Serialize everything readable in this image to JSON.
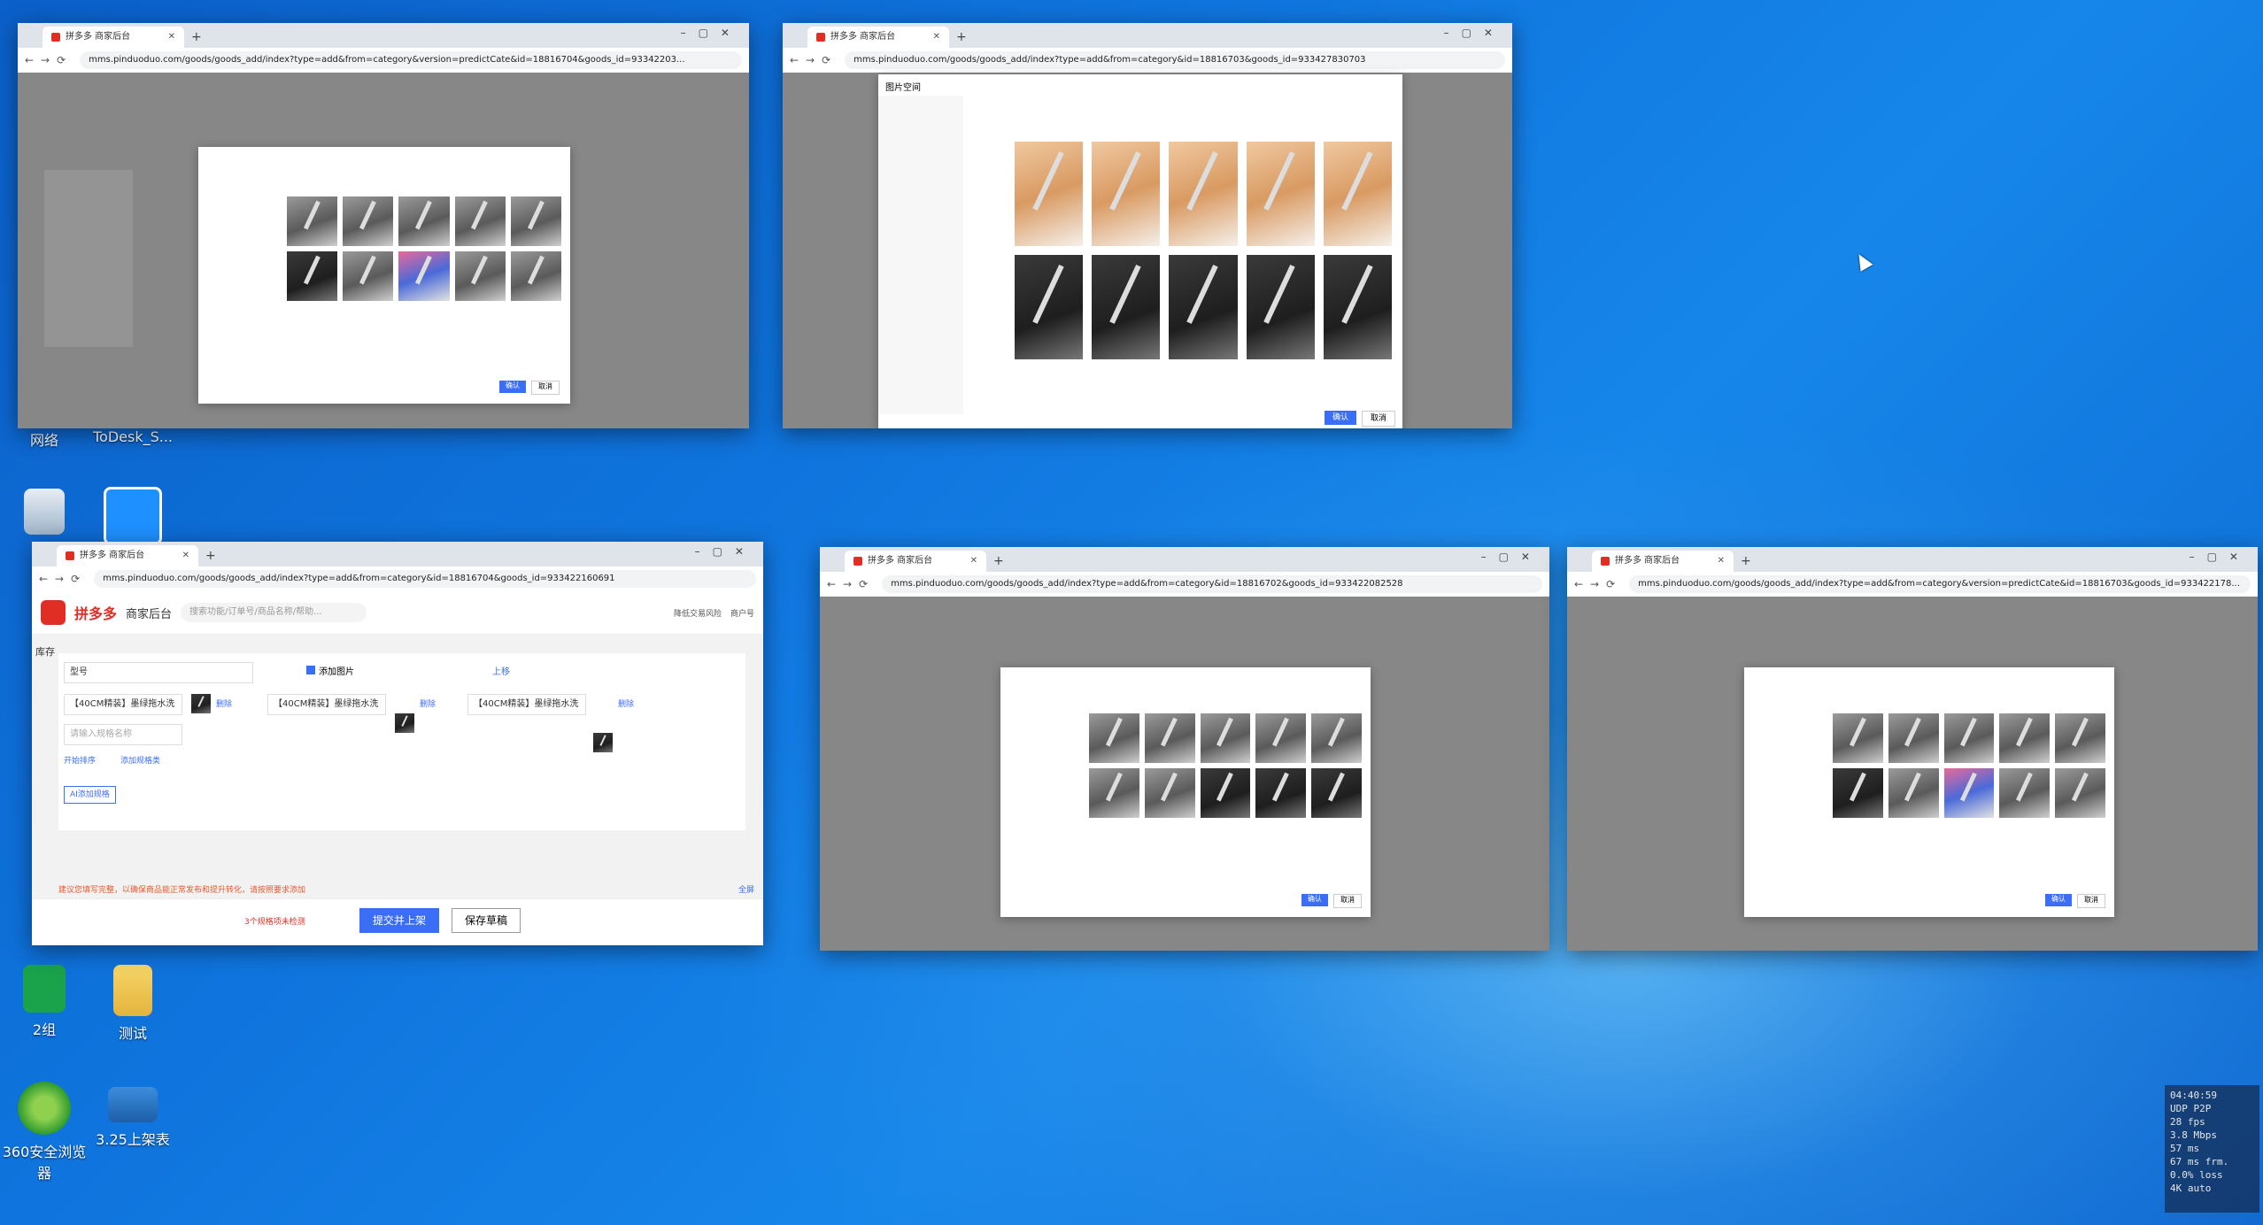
{
  "desktop": {
    "icons": [
      {
        "label": "网络"
      },
      {
        "label": "ToDesk_S..."
      },
      {
        "label": "2组"
      },
      {
        "label": "测试"
      },
      {
        "label": "360安全浏览器"
      },
      {
        "label": "3.25上架表"
      }
    ]
  },
  "browser": {
    "tab_title": "拼多多 商家后台",
    "url_main": "mms.pinduoduo.com/goods/goods_add/index?type=add&from=category&id=18816704&goods_id=933422160691",
    "url_top_left": "mms.pinduoduo.com/goods/goods_add/index?type=add&from=category&version=predictCate&id=18816704&goods_id=93342203...",
    "url_top_right": "mms.pinduoduo.com/goods/goods_add/index?type=add&from=category&id=18816703&goods_id=933427830703",
    "url_bottom_mid": "mms.pinduoduo.com/goods/goods_add/index?type=add&from=category&id=18816702&goods_id=933422082528",
    "url_bottom_right": "mms.pinduoduo.com/goods/goods_add/index?type=add&from=category&version=predictCate&id=18816703&goods_id=933422178..."
  },
  "main_window": {
    "brand": "拼多多",
    "brand_sub": "商家后台",
    "search_placeholder": "搜索功能/订单号/商品名称/帮助...",
    "spec_label": "型号",
    "add_image_label": "添加图片",
    "upload_label": "上移",
    "sku_items": [
      "【40CM精装】墨绿拖水洗",
      "【40CM精装】墨绿拖水洗",
      "【40CM精装】墨绿拖水洗"
    ],
    "delete_label": "删除",
    "input_placeholder": "请输入规格名称",
    "batch_label": "开始排序",
    "add_spec_link": "添加规格类",
    "ai_button": "AI添加规格",
    "warning_text": "建议您填写完整，以确保商品能正常发布和提升转化，请按照要求添加",
    "full_screen_link": "全屏",
    "footer_hint": "3个规格项未检测",
    "submit_button": "提交并上架",
    "save_draft_button": "保存草稿",
    "side_label": "库存",
    "side_right_1": "降低交易风险",
    "side_right_2": "商户号"
  },
  "image_modal": {
    "title": "图片空间",
    "confirm": "确认",
    "cancel": "取消"
  },
  "stats_overlay": {
    "lines": [
      "04:40:59",
      "UDP P2P",
      "28 fps",
      "3.8 Mbps",
      "57 ms",
      "67 ms frm.",
      "0.0% loss",
      "4K auto"
    ]
  },
  "colors": {
    "brand_red": "#e02e24",
    "accent_blue": "#3b6ef6",
    "desktop_blue": "#0f74dd"
  }
}
